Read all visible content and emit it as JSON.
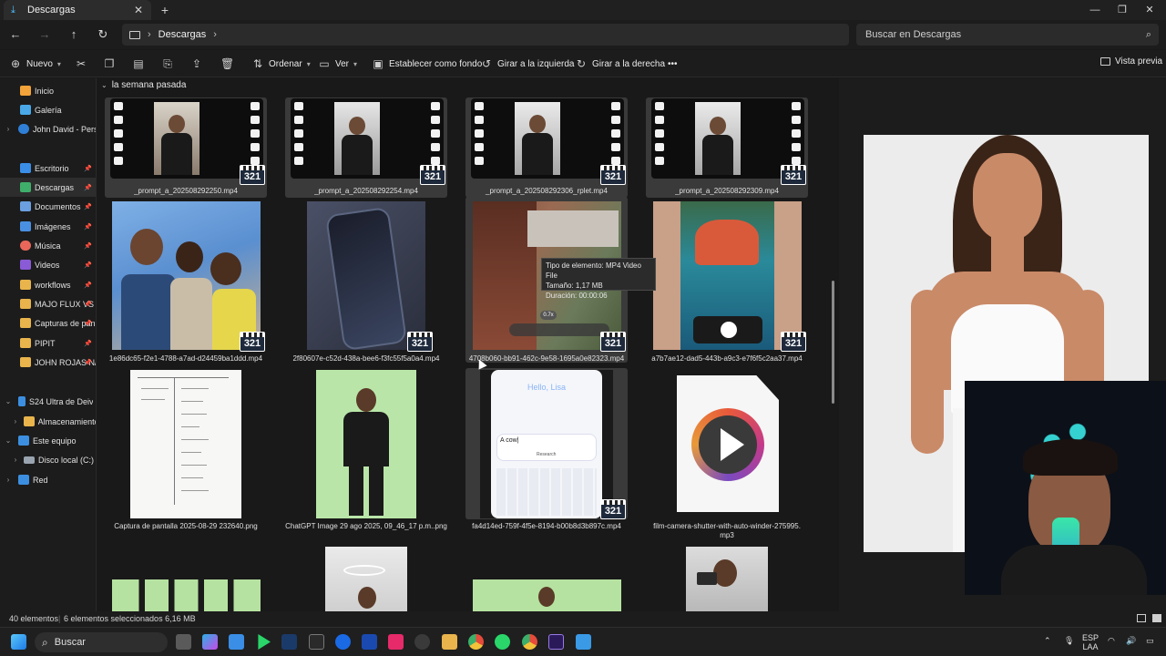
{
  "window": {
    "tab_title": "Descargas",
    "tab_close": "✕",
    "new_tab": "+",
    "minimize": "—",
    "restore": "❐",
    "close": "✕"
  },
  "address": {
    "crumb": "Descargas",
    "search_placeholder": "Buscar en Descargas"
  },
  "toolbar": {
    "new_label": "Nuevo",
    "sort_label": "Ordenar",
    "view_label": "Ver",
    "set_bg_label": "Establecer como fondo",
    "rotate_left_label": "Girar a la izquierda",
    "rotate_right_label": "Girar a la derecha",
    "more_label": "•••",
    "preview_label": "Vista previa"
  },
  "sidebar": {
    "items": [
      {
        "label": "Inicio",
        "icon": "home-icon",
        "color": "#f2a33a"
      },
      {
        "label": "Galería",
        "icon": "gallery-icon",
        "color": "#4aa8e8"
      },
      {
        "label": "John David - Perso",
        "icon": "cloud-icon",
        "color": "#2f7fd6"
      },
      {
        "label": "Escritorio",
        "icon": "desktop-icon",
        "color": "#3a8ee6"
      },
      {
        "label": "Descargas",
        "icon": "download-icon",
        "color": "#3fae6a"
      },
      {
        "label": "Documentos",
        "icon": "documents-icon",
        "color": "#6b9fe0"
      },
      {
        "label": "Imágenes",
        "icon": "images-icon",
        "color": "#4a90e2"
      },
      {
        "label": "Música",
        "icon": "music-icon",
        "color": "#e8675a"
      },
      {
        "label": "Videos",
        "icon": "videos-icon",
        "color": "#8a5bd6"
      },
      {
        "label": "workflows",
        "icon": "folder-icon",
        "color": "#e9b44c"
      },
      {
        "label": "MAJO FLUX VS I",
        "icon": "folder-icon",
        "color": "#e9b44c"
      },
      {
        "label": "Capturas de pan",
        "icon": "folder-icon",
        "color": "#e9b44c"
      },
      {
        "label": "PIPIT",
        "icon": "folder-icon",
        "color": "#e9b44c"
      },
      {
        "label": "JOHN ROJAS N/",
        "icon": "folder-icon",
        "color": "#e9b44c"
      },
      {
        "label": "S24 Ultra de Deivjh",
        "icon": "phone-icon",
        "color": "#3c8fe0"
      },
      {
        "label": "Almacenamiento",
        "icon": "folder-icon",
        "color": "#e9b44c"
      },
      {
        "label": "Este equipo",
        "icon": "computer-icon",
        "color": "#3c8fe0"
      },
      {
        "label": "Disco local (C:)",
        "icon": "drive-icon",
        "color": "#9aa4b0"
      },
      {
        "label": "Red",
        "icon": "network-icon",
        "color": "#3c8fe0"
      }
    ]
  },
  "group_header": "la semana pasada",
  "files": [
    "_prompt_a_202508292250.mp4",
    "_prompt_a_202508292254.mp4",
    "_prompt_a_202508292306_rplet.mp4",
    "_prompt_a_202508292309.mp4",
    "1e86dc65-f2e1-4788-a7ad-d24459ba1ddd.mp4",
    "2f80607e-c52d-438a-bee6-f3fc55f5a0a4.mp4",
    "4708b060-bb91-462c-9e58-1695a0e82323.mp4",
    "a7b7ae12-dad5-443b-a9c3-e7f6f5c2aa37.mp4",
    "Captura de pantalla 2025-08-29 232640.png",
    "ChatGPT Image 29 ago 2025, 09_46_17 p.m..png",
    "fa4d14ed-759f-4f5e-8194-b00b8d3b897c.mp4",
    "film-camera-shutter-with-auto-winder-275995.",
    "mp3"
  ],
  "badge": "321",
  "thumb_text": {
    "hello": "Hello, Lisa",
    "prompt": "A cow|",
    "research": "Research",
    "slider": "0.7x"
  },
  "tooltip": {
    "type": "Tipo de elemento: MP4 Video File",
    "size": "Tamaño: 1,17 MB",
    "duration": "Duración: 00:00:06"
  },
  "status": {
    "count": "40 elementos",
    "selected": "6 elementos seleccionados  6,16 MB"
  },
  "taskbar": {
    "search_label": "Buscar",
    "lang_top": "ESP",
    "lang_bottom": "LAA"
  },
  "colors": {
    "accent": "#4cc2ff",
    "background": "#191919"
  }
}
